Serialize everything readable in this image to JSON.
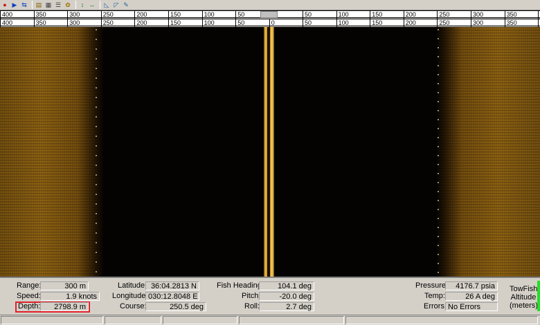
{
  "toolbar": {
    "buttons": [
      {
        "icon": "record-icon",
        "glyph": "●",
        "color": "#cc1010"
      },
      {
        "icon": "play-icon",
        "glyph": "▶",
        "color": "#1040c0"
      },
      {
        "icon": "replay-icon",
        "glyph": "⇆",
        "color": "#1040c0"
      },
      {
        "icon": "open-file-icon",
        "glyph": "▤",
        "color": "#806000"
      },
      {
        "icon": "save-image-icon",
        "glyph": "▦",
        "color": "#404040"
      },
      {
        "icon": "settings-icon",
        "glyph": "☰",
        "color": "#404040"
      },
      {
        "icon": "palette-icon",
        "glyph": "✿",
        "color": "#a07000"
      },
      {
        "icon": "zoom-in-icon",
        "glyph": "↕",
        "color": "#208020"
      },
      {
        "icon": "zoom-out-icon",
        "glyph": "↔",
        "color": "#208020"
      },
      {
        "icon": "measure-icon",
        "glyph": "◺",
        "color": "#2060a0"
      },
      {
        "icon": "target-icon",
        "glyph": "◸",
        "color": "#2060a0"
      },
      {
        "icon": "annotate-icon",
        "glyph": "✎",
        "color": "#2060a0"
      }
    ]
  },
  "scale": {
    "left_ticks": [
      "400",
      "350",
      "300",
      "250",
      "200",
      "150",
      "100",
      "50"
    ],
    "right_ticks": [
      "50",
      "100",
      "150",
      "200",
      "250",
      "300",
      "350",
      "400"
    ],
    "bottom_left_ticks": [
      "400",
      "350",
      "300",
      "250",
      "200",
      "150",
      "100",
      "50",
      "0"
    ],
    "bottom_right_ticks": [
      "50",
      "100",
      "150",
      "200",
      "250",
      "300",
      "350",
      "400"
    ]
  },
  "status": {
    "range_label": "Range:",
    "range_value": "300 m",
    "speed_label": "Speed:",
    "speed_value": "1.9 knots",
    "depth_label": "Depth:",
    "depth_value": "2798.9 m",
    "latitude_label": "Latitude:",
    "latitude_value": "36:04.2813 N",
    "longitude_label": "Longitude:",
    "longitude_value": "030:12.8048 E",
    "course_label": "Course:",
    "course_value": "250.5 deg",
    "heading_label": "Fish Heading:",
    "heading_value": "104.1 deg",
    "pitch_label": "Pitch:",
    "pitch_value": "-20.0 deg",
    "roll_label": "Roll:",
    "roll_value": "2.7 deg",
    "pressure_label": "Pressure:",
    "pressure_value": "4176.7 psia",
    "temp_label": "Temp:",
    "temp_value": "26 A deg",
    "errors_label": "Errors:",
    "errors_value": "No Errors",
    "towfish_line1": "TowFish",
    "towfish_line2": "Altitude",
    "towfish_line3": "(meters)"
  },
  "colors": {
    "depth_highlight": "#e0202a",
    "altitude_indicator": "#22e022",
    "sonar_return": "#a87416"
  }
}
